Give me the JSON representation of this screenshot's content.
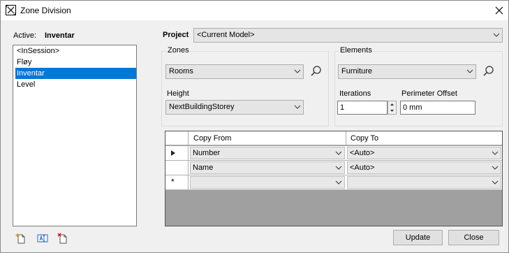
{
  "window": {
    "title": "Zone Division"
  },
  "active": {
    "label": "Active:",
    "value": "Inventar"
  },
  "list": {
    "items": [
      "<InSession>",
      "Fløy",
      "Inventar",
      "Level"
    ],
    "selected_index": 2
  },
  "project": {
    "label": "Project",
    "value": "<Current Model>"
  },
  "zones": {
    "group_label": "Zones",
    "value": "Rooms",
    "height_label": "Height",
    "height_value": "NextBuildingStorey"
  },
  "elements": {
    "group_label": "Elements",
    "value": "Furniture",
    "iterations_label": "Iterations",
    "iterations_value": "1",
    "offset_label": "Perimeter Offset",
    "offset_value": "0 mm"
  },
  "grid": {
    "columns": [
      "Copy From",
      "Copy To"
    ],
    "rows": [
      {
        "marker": "▶",
        "from": "Number",
        "to": "<Auto>"
      },
      {
        "marker": "",
        "from": "Name",
        "to": "<Auto>"
      },
      {
        "marker": "*",
        "from": "",
        "to": ""
      }
    ]
  },
  "buttons": {
    "update": "Update",
    "close": "Close"
  },
  "toolbar_icons": [
    "new-item-icon",
    "rename-icon",
    "delete-item-icon"
  ],
  "colors": {
    "selection": "#0078d7",
    "grid_empty": "#a0a0a0"
  }
}
